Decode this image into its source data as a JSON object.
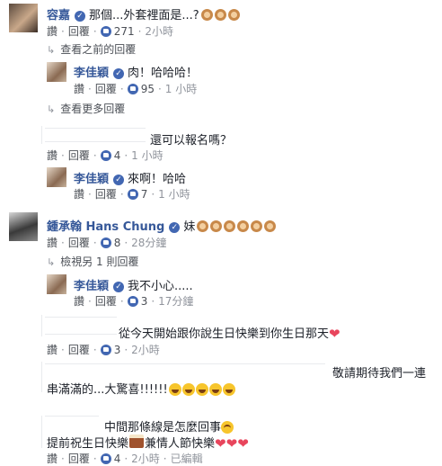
{
  "actions": {
    "like": "讚",
    "reply": "回覆",
    "dot": "·"
  },
  "c1": {
    "name": "容嘉",
    "text": "那個...外套裡面是...?",
    "likes": "271",
    "time": "2小時",
    "view_prev": "查看之前的回覆"
  },
  "r1": {
    "name": "李佳穎",
    "text": "肉！哈哈哈！",
    "likes": "95",
    "time": "1 小時",
    "view_more": "查看更多回覆"
  },
  "c2": {
    "text": "還可以報名嗎？",
    "likes": "4",
    "time": "1 小時"
  },
  "r2": {
    "name": "李佳穎",
    "text": "來啊！哈哈",
    "likes": "7",
    "time": "1 小時"
  },
  "c3": {
    "name": "鍾承翰 Hans Chung",
    "text": "妹",
    "likes": "8",
    "time": "28分鐘",
    "view_one": "檢視另 1 則回覆"
  },
  "r3": {
    "name": "李佳穎",
    "text": "我不小心.....",
    "likes": "3",
    "time": "17分鐘"
  },
  "c4": {
    "text": "從今天開始跟你說生日快樂到你生日那天",
    "likes": "3",
    "time": "2小時"
  },
  "c5": {
    "line1": "敬請期待我們一連",
    "line2": "串滿滿的...大驚喜!!!!!!"
  },
  "c6": {
    "line1": "中間那條線是怎麼回事",
    "line2a": "提前祝生日快樂",
    "line2b": "兼情人節快樂",
    "likes": "4",
    "time": "2小時",
    "edited": "已編輯"
  },
  "icons": {
    "verified": "verified-badge-icon",
    "like": "like-thumb-icon",
    "reply_arrow": "reply-arrow-icon"
  }
}
